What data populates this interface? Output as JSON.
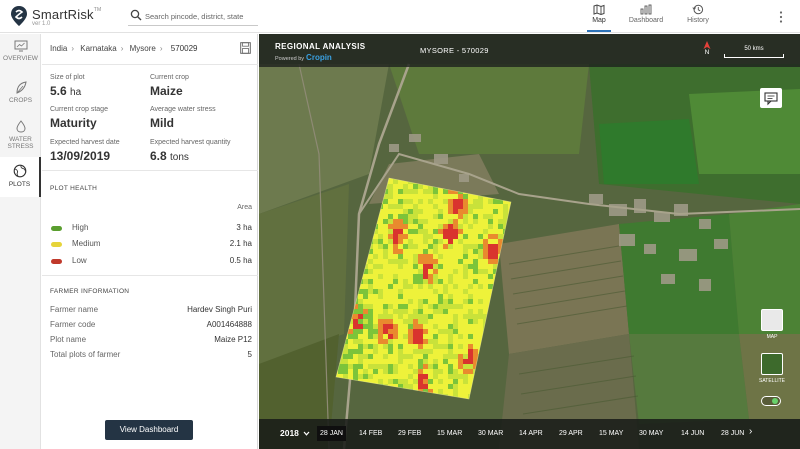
{
  "app": {
    "name": "SmartRisk",
    "trademark": "TM",
    "version": "ver 1.0"
  },
  "search": {
    "placeholder": "Search pincode, district, state"
  },
  "top_nav": [
    {
      "label": "Map",
      "icon": "map-icon",
      "active": true
    },
    {
      "label": "Dashboard",
      "icon": "bar-chart-icon",
      "active": false
    },
    {
      "label": "History",
      "icon": "history-icon",
      "active": false
    }
  ],
  "left_rail": [
    {
      "label": "OVERVIEW",
      "icon": "monitor-icon"
    },
    {
      "label": "CROPS",
      "icon": "leaf-icon"
    },
    {
      "label": "WATER STRESS",
      "line1": "WATER",
      "line2": "STRESS",
      "icon": "water-drop-icon"
    },
    {
      "label": "PLOTS",
      "icon": "globe-icon",
      "active": true
    }
  ],
  "breadcrumb": {
    "country": "India",
    "state": "Karnataka",
    "district": "Mysore",
    "pincode": "570029"
  },
  "stats": {
    "plot_size_label": "Size of plot",
    "plot_size_value": "5.6",
    "plot_size_unit": "ha",
    "current_crop_label": "Current crop",
    "current_crop_value": "Maize",
    "crop_stage_label": "Current crop stage",
    "crop_stage_value": "Maturity",
    "water_stress_label": "Average water stress",
    "water_stress_value": "Mild",
    "harvest_date_label": "Expected harvest date",
    "harvest_date_value": "13/09/2019",
    "harvest_qty_label": "Expected harvest quantity",
    "harvest_qty_value": "6.8",
    "harvest_qty_unit": "tons"
  },
  "plot_health": {
    "title": "PLOT HEALTH",
    "area_header": "Area",
    "rows": [
      {
        "label": "High",
        "value": "3 ha",
        "color": "#5a9e2f"
      },
      {
        "label": "Medium",
        "value": "2.1 ha",
        "color": "#e6d43a"
      },
      {
        "label": "Low",
        "value": "0.5 ha",
        "color": "#c0392b"
      }
    ]
  },
  "farmer": {
    "title": "FARMER INFORMATION",
    "rows": [
      {
        "label": "Farmer name",
        "value": "Hardev Singh Puri"
      },
      {
        "label": "Farmer code",
        "value": "A001464888"
      },
      {
        "label": "Plot name",
        "value": "Maize P12"
      },
      {
        "label": "Total plots of farmer",
        "value": "5"
      }
    ]
  },
  "cta": {
    "label": "View Dashboard"
  },
  "map": {
    "title": "REGIONAL ANALYSIS",
    "powered_by": "Powered by",
    "powered_brand": "Cropin",
    "location": "MYSORE - 570029",
    "north_label": "N",
    "scale_label": "50 kms",
    "layer_map_label": "MAP",
    "layer_satellite_label": "SATELLITE",
    "heat_colors": [
      "#2e9a2e",
      "#7cc43a",
      "#c9e23a",
      "#eef23a",
      "#e98a2e",
      "#d9342e"
    ]
  },
  "timeline": {
    "year": "2018",
    "dates": [
      "28 JAN",
      "14 FEB",
      "29 FEB",
      "15 MAR",
      "30 MAR",
      "14 APR",
      "29 APR",
      "15 MAY",
      "30 MAY",
      "14 JUN",
      "28 JUN"
    ],
    "active_index": 0
  }
}
